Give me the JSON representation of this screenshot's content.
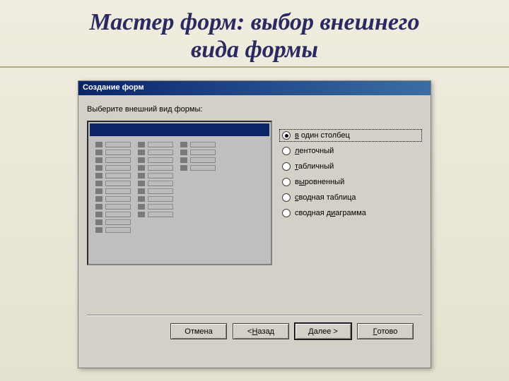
{
  "slide": {
    "title_line1": "Мастер форм: выбор внешнего",
    "title_line2": "вида формы"
  },
  "dialog": {
    "title": "Создание форм",
    "instruction": "Выберите внешний вид формы:"
  },
  "options": {
    "items": [
      {
        "label": "в один столбец",
        "underline": "в",
        "selected": true
      },
      {
        "label": "ленточный",
        "underline": "л",
        "selected": false
      },
      {
        "label": "табличный",
        "underline": "т",
        "selected": false
      },
      {
        "label": "выровненный",
        "underline": "ы",
        "selected": false
      },
      {
        "label": "сводная таблица",
        "underline": "с",
        "selected": false
      },
      {
        "label": "сводная диаграмма",
        "underline": "и",
        "selected": false
      }
    ]
  },
  "buttons": {
    "cancel": "Отмена",
    "back": "< Назад",
    "next": "Далее >",
    "finish": "Готово"
  }
}
